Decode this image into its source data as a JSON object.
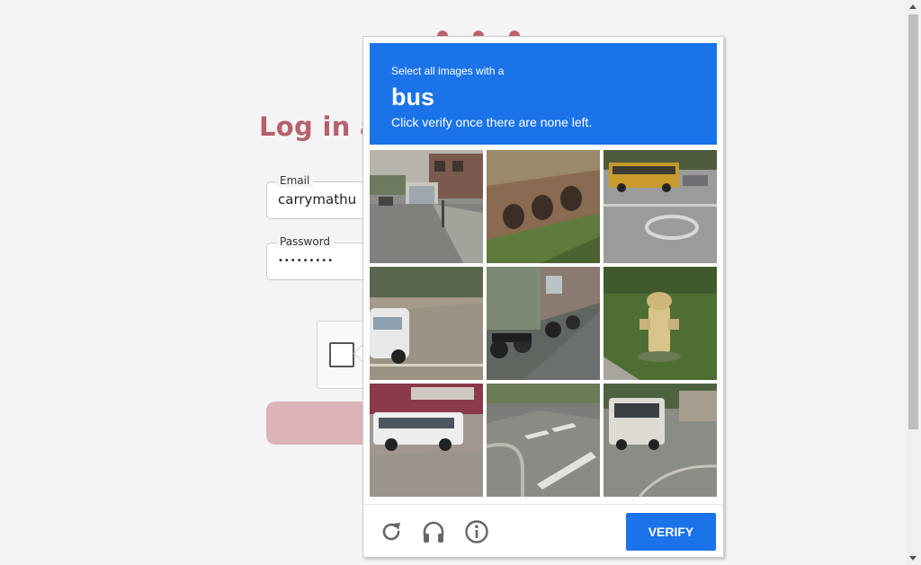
{
  "login": {
    "title": "Log in a",
    "email_label": "Email",
    "email_value": "carrymathu",
    "password_label": "Password",
    "password_value": "•••••••••"
  },
  "captcha": {
    "instruction_line1": "Select all images with a",
    "target_object": "bus",
    "instruction_line2": "Click verify once there are none left.",
    "tiles": [
      {
        "content": "street with bus shelter"
      },
      {
        "content": "stone bridge on hillside"
      },
      {
        "content": "yellow school bus"
      },
      {
        "content": "white car on road"
      },
      {
        "content": "parked motorcycles"
      },
      {
        "content": "yellow fire hydrant"
      },
      {
        "content": "white shuttle bus"
      },
      {
        "content": "crosswalk"
      },
      {
        "content": "white bus on street"
      }
    ],
    "footer": {
      "reload_icon": "reload-icon",
      "audio_icon": "headphones-icon",
      "info_icon": "info-icon",
      "verify_label": "VERIFY"
    },
    "colors": {
      "accent": "#1a73e8"
    }
  }
}
